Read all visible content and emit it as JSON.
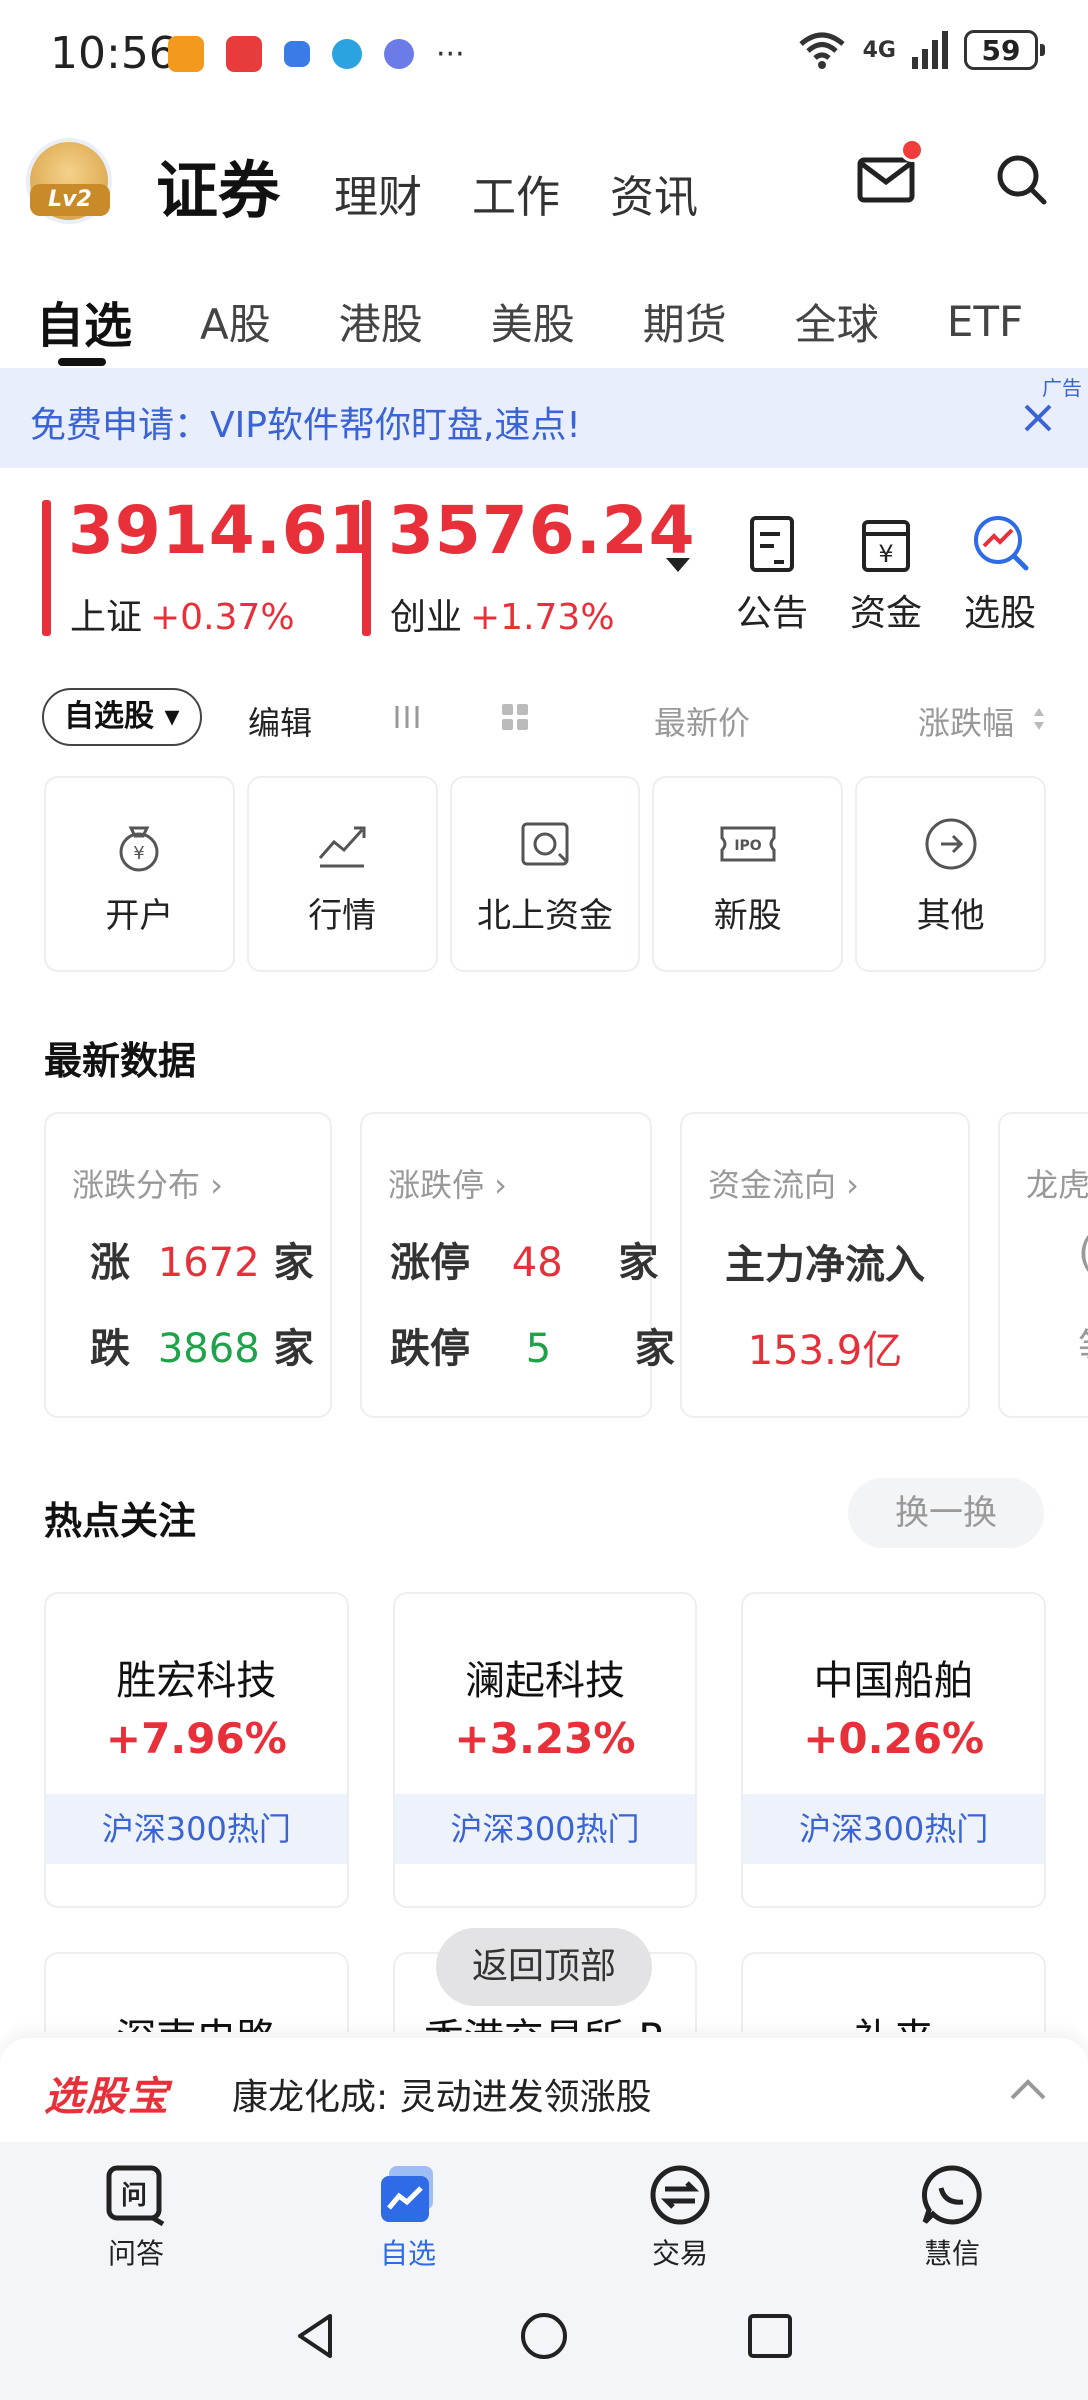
{
  "status_bar": {
    "time": "10:56",
    "more": "···",
    "signal": "4G",
    "battery": "59"
  },
  "header": {
    "avatar_badge": "Lv2",
    "nav": [
      {
        "label": "证券",
        "active": true
      },
      {
        "label": "理财"
      },
      {
        "label": "工作"
      },
      {
        "label": "资讯"
      }
    ]
  },
  "market_tabs": [
    "自选",
    "A股",
    "港股",
    "美股",
    "期货",
    "全球",
    "ETF"
  ],
  "ad": {
    "text": "免费申请：VIP软件帮你盯盘,速点!",
    "label": "广告"
  },
  "indices": [
    {
      "value": "3914.61",
      "name": "上证",
      "change": "+0.37%"
    },
    {
      "value": "3576.24",
      "name": "创业",
      "change": "+1.73%"
    }
  ],
  "quick_actions": [
    "公告",
    "资金",
    "选股"
  ],
  "toolbar": {
    "watchlist": "自选股",
    "edit": "编辑",
    "latest_price": "最新价",
    "change_pct": "涨跌幅"
  },
  "services": [
    "开户",
    "行情",
    "北上资金",
    "新股",
    "其他"
  ],
  "latest_data": {
    "title": "最新数据",
    "distribution": {
      "head": "涨跌分布 ›",
      "up_label": "涨",
      "up": "1672",
      "down_label": "跌",
      "down": "3868",
      "unit": "家"
    },
    "limit": {
      "head": "涨跌停 ›",
      "up_label": "涨停",
      "up": "48",
      "down_label": "跌停",
      "down": "5",
      "unit": "家"
    },
    "flow": {
      "head": "资金流向 ›",
      "label": "主力净流入",
      "amount": "153.9亿"
    },
    "partial": {
      "head": "龙虎",
      "mid": "(",
      "bottom": "等"
    }
  },
  "hot_focus": {
    "title": "热点关注",
    "swap": "换一换",
    "items": [
      {
        "name": "胜宏科技",
        "change": "+7.96%",
        "tag": "沪深300热门"
      },
      {
        "name": "澜起科技",
        "change": "+3.23%",
        "tag": "沪深300热门"
      },
      {
        "name": "中国船舶",
        "change": "+0.26%",
        "tag": "沪深300热门"
      }
    ],
    "items2": [
      "深南电路",
      "香港交易所-R",
      "礼来"
    ]
  },
  "back_to_top": "返回顶部",
  "picker": {
    "logo": "选股宝",
    "headline": "康龙化成: 灵动进发领涨股"
  },
  "bottom_nav": [
    {
      "label": "问答"
    },
    {
      "label": "自选",
      "active": true
    },
    {
      "label": "交易"
    },
    {
      "label": "慧信"
    }
  ],
  "colors": {
    "up": "#e8303a",
    "down": "#1fa34a",
    "accent": "#2f6be6",
    "ad_text": "#3a63d6"
  }
}
